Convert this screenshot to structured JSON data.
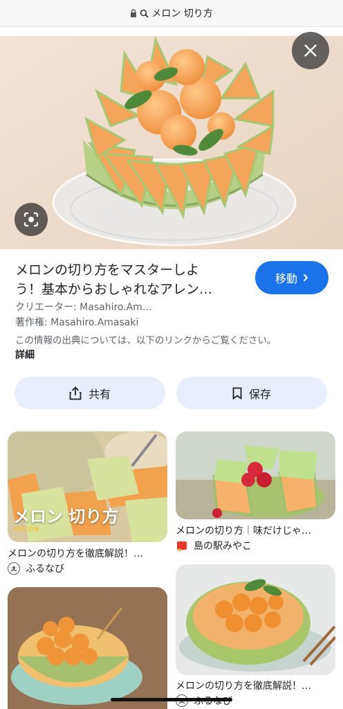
{
  "browser": {
    "url_text": "メロン 切り方"
  },
  "result": {
    "title_line1": "メロンの切り方をマスターしよ",
    "title_line2": "う！基本からおしゃれなアレン…",
    "visit_label": "移動",
    "creator": "クリエーター: Masahiro.Am…",
    "copyright": "著作権: Masahiro.Amasaki",
    "notice": "この情報の出典については、以下のリンクからご覧ください。",
    "details_label": "詳細",
    "share_label": "共有",
    "save_label": "保存"
  },
  "related": [
    {
      "overlay_title": "メロン 切り方",
      "overlay_sub": "MELON",
      "caption": "メロンの切り方を徹底解説！…",
      "source": "ふるなび"
    },
    {
      "caption": "メロンの切り方｜味だけじゃ…",
      "source": "島の駅みやこ"
    },
    {
      "caption": ""
    },
    {
      "caption": "メロンの切り方を徹底解説！…",
      "source": "ふるなび"
    }
  ],
  "colors": {
    "accent": "#1a73e8",
    "pill_bg": "#e8eefb",
    "melon_orange": "#f4a45c",
    "melon_green": "#b8cf86"
  },
  "icons": [
    "lock-icon",
    "search-icon",
    "close-icon",
    "lens-icon",
    "chevron-right-icon",
    "share-icon",
    "bookmark-icon"
  ]
}
